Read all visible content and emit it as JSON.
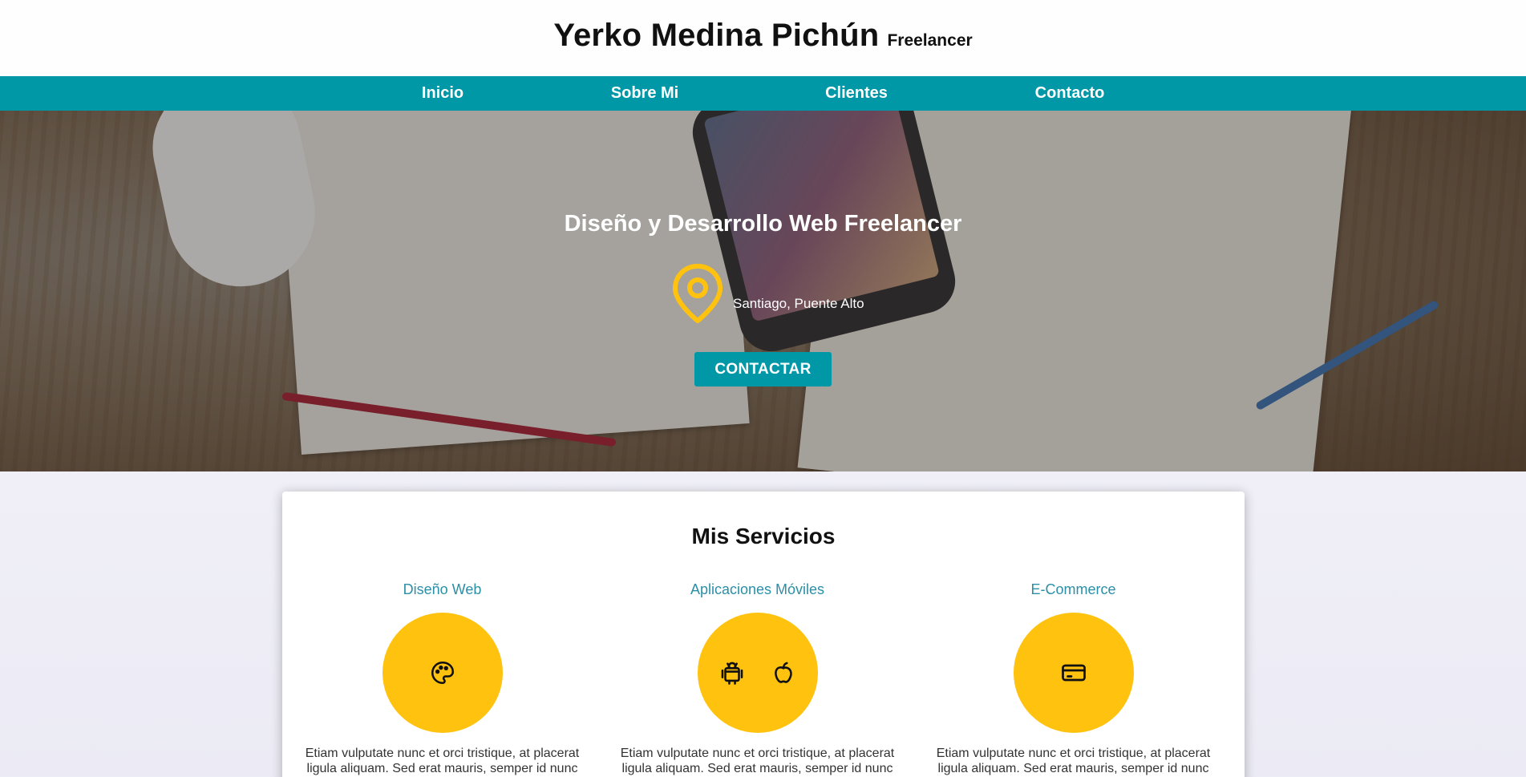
{
  "header": {
    "name": "Yerko Medina Pichún",
    "tagline": "Freelancer"
  },
  "nav": {
    "items": [
      {
        "label": "Inicio"
      },
      {
        "label": "Sobre Mi"
      },
      {
        "label": "Clientes"
      },
      {
        "label": "Contacto"
      }
    ]
  },
  "hero": {
    "title": "Diseño y Desarrollo Web Freelancer",
    "location": "Santiago, Puente Alto",
    "location_icon": "map-pin-icon",
    "cta_label": "CONTACTAR"
  },
  "services": {
    "title": "Mis Servicios",
    "items": [
      {
        "name": "Diseño Web",
        "icons": [
          "palette-icon"
        ],
        "description": "Etiam vulputate nunc et orci tristique, at placerat ligula aliquam. Sed erat mauris, semper id nunc"
      },
      {
        "name": "Aplicaciones Móviles",
        "icons": [
          "android-icon",
          "apple-icon"
        ],
        "description": "Etiam vulputate nunc et orci tristique, at placerat ligula aliquam. Sed erat mauris, semper id nunc"
      },
      {
        "name": "E-Commerce",
        "icons": [
          "credit-card-icon"
        ],
        "description": "Etiam vulputate nunc et orci tristique, at placerat ligula aliquam. Sed erat mauris, semper id nunc"
      }
    ]
  },
  "colors": {
    "accent": "#0097a7",
    "highlight": "#fec20f",
    "service_title": "#2b8fa6"
  }
}
